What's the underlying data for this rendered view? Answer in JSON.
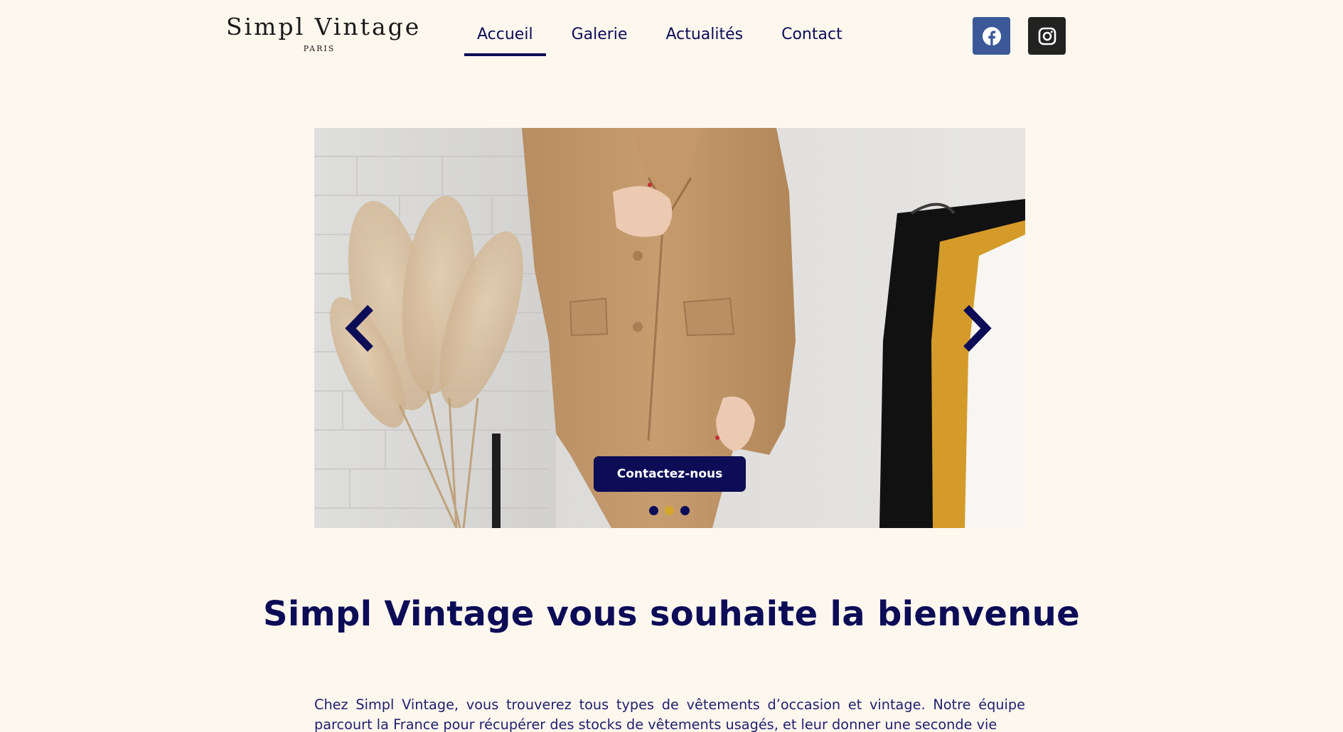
{
  "brand": {
    "name": "Simpl Vintage",
    "location": "PARIS"
  },
  "nav": {
    "items": [
      {
        "label": "Accueil",
        "active": true
      },
      {
        "label": "Galerie",
        "active": false
      },
      {
        "label": "Actualités",
        "active": false
      },
      {
        "label": "Contact",
        "active": false
      }
    ]
  },
  "social": [
    {
      "icon": "facebook-icon",
      "color": "#3b5998"
    },
    {
      "icon": "instagram-icon",
      "color": "#222222"
    }
  ],
  "slider": {
    "cta_label": "Contactez-nous",
    "slide_count": 3,
    "active_slide": 2,
    "prev_icon": "chevron-left-icon",
    "next_icon": "chevron-right-icon"
  },
  "welcome": {
    "title": "Simpl Vintage vous souhaite la bienvenue",
    "intro": "Chez Simpl Vintage, vous trouverez tous types de vêtements d’occasion et vintage. Notre équipe parcourt la France pour récupérer des stocks de vêtements usagés, et leur donner une seconde vie"
  },
  "colors": {
    "background": "#fdf7ee",
    "primary": "#0c0c57",
    "accent": "#d4a72c"
  }
}
